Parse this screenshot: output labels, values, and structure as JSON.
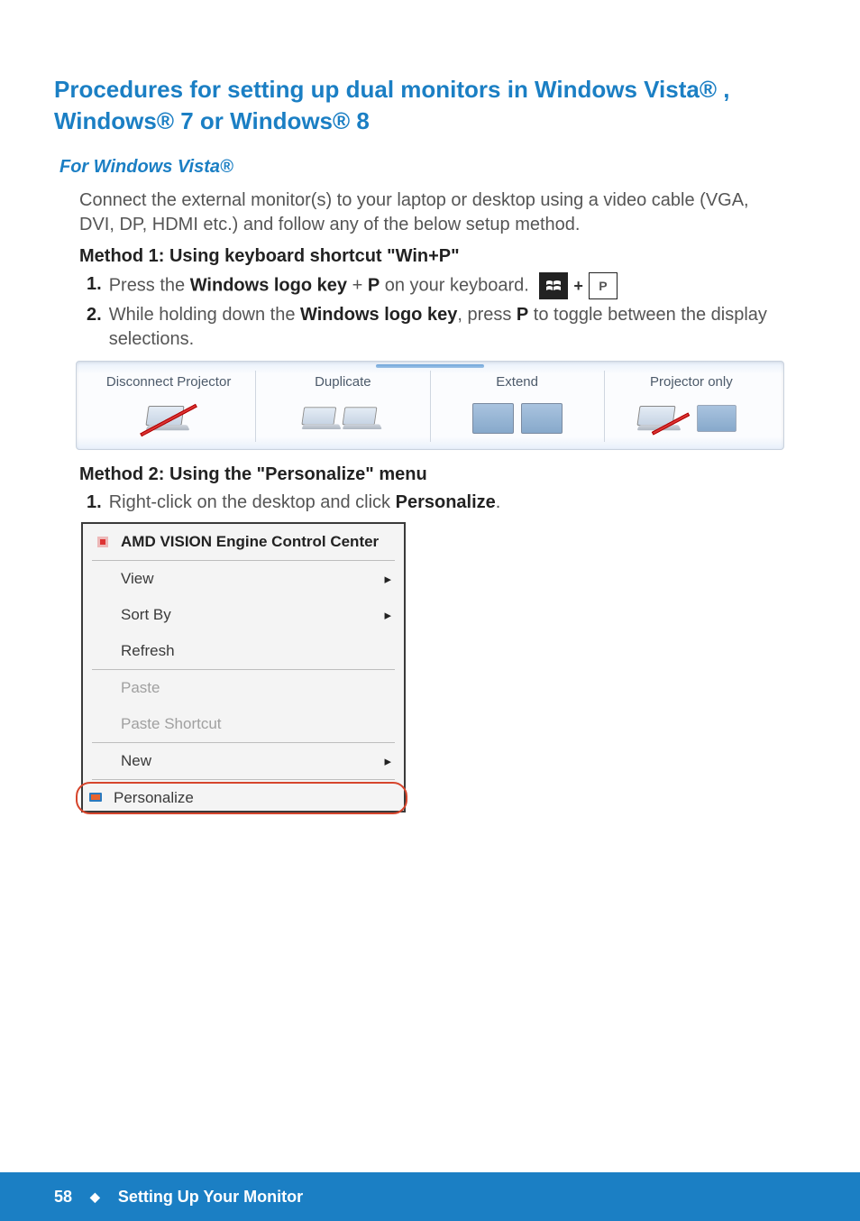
{
  "main_heading": "Procedures for setting up dual monitors in Windows Vista® , Windows® 7 or Windows® 8",
  "sub_heading": "For Windows Vista®",
  "intro_text": "Connect the external monitor(s) to your laptop or desktop using a video cable (VGA, DVI, DP, HDMI etc.) and follow any of the below setup method.",
  "method1": {
    "heading": "Method 1: Using keyboard shortcut \"Win+P\"",
    "step1_num": "1.",
    "step1_a": "Press the ",
    "step1_b": "Windows logo key",
    "step1_c": " + ",
    "step1_d": "P",
    "step1_e": " on your keyboard.",
    "p_key_label": "P",
    "step2_num": "2.",
    "step2_a": "While holding down the ",
    "step2_b": "Windows logo key",
    "step2_c": ", press ",
    "step2_d": "P",
    "step2_e": " to toggle between the display selections."
  },
  "projector": {
    "disconnect": "Disconnect Projector",
    "duplicate": "Duplicate",
    "extend": "Extend",
    "projector_only": "Projector only"
  },
  "method2": {
    "heading": "Method 2: Using the \"Personalize\" menu",
    "step1_num": "1.",
    "step1_a": "Right-click on the desktop and click ",
    "step1_b": "Personalize",
    "step1_c": "."
  },
  "context_menu": {
    "amd": "AMD VISION Engine Control Center",
    "view": "View",
    "sort_by": "Sort By",
    "refresh": "Refresh",
    "paste": "Paste",
    "paste_shortcut": "Paste Shortcut",
    "new_item": "New",
    "personalize": "Personalize"
  },
  "footer": {
    "page": "58",
    "diamond": "◆",
    "section": "Setting Up Your Monitor"
  }
}
